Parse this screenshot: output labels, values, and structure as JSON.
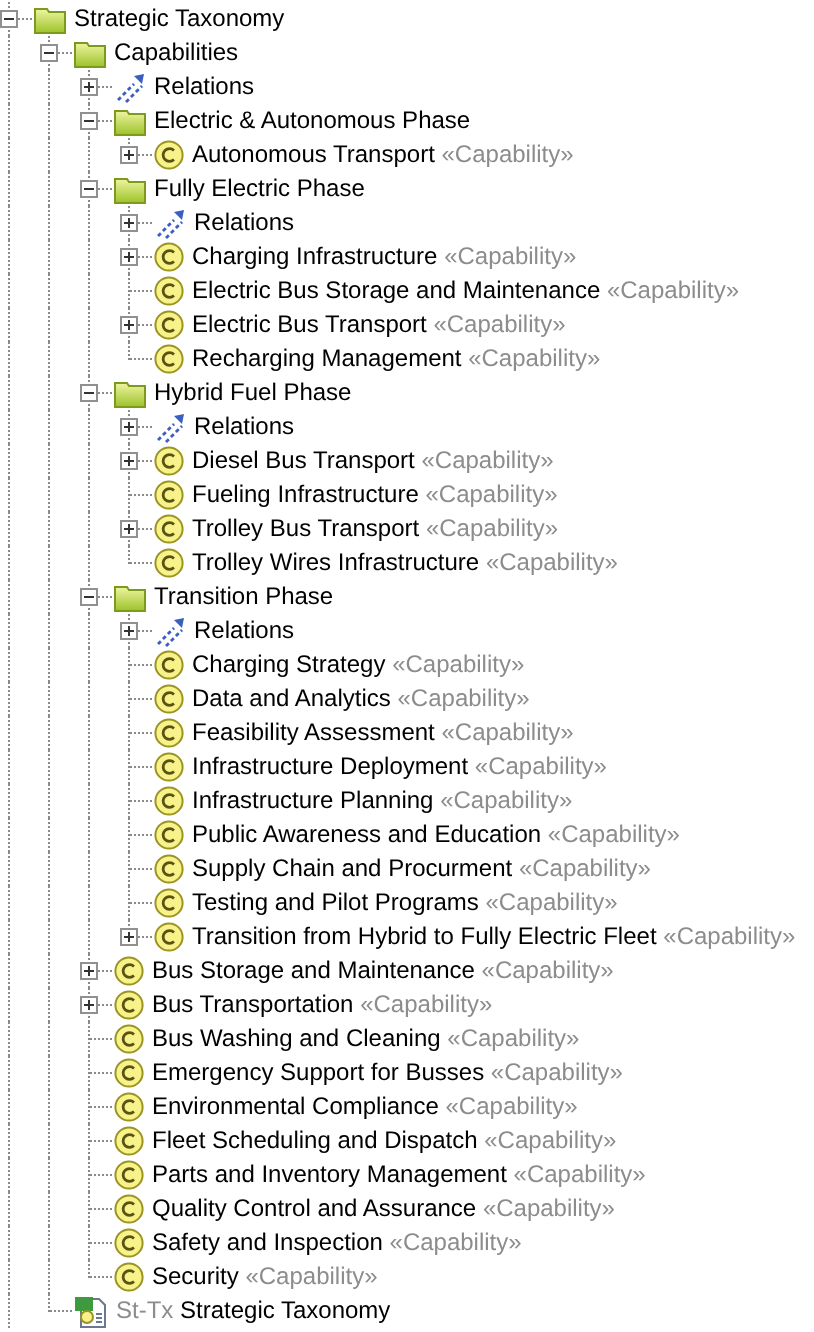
{
  "tree": [
    {
      "label": "Strategic Taxonomy",
      "kind": "folder",
      "expanded": true,
      "children": [
        {
          "label": "Capabilities",
          "kind": "folder",
          "expanded": true,
          "children": [
            {
              "label": "Relations",
              "kind": "relations",
              "expanded": false
            },
            {
              "label": "Electric & Autonomous Phase",
              "kind": "folder",
              "expanded": true,
              "children": [
                {
                  "label": "Autonomous Transport",
                  "kind": "capability",
                  "stereotype": "«Capability»",
                  "expanded": false
                }
              ]
            },
            {
              "label": "Fully Electric Phase",
              "kind": "folder",
              "expanded": true,
              "children": [
                {
                  "label": "Relations",
                  "kind": "relations",
                  "expanded": false
                },
                {
                  "label": "Charging Infrastructure",
                  "kind": "capability",
                  "stereotype": "«Capability»",
                  "expanded": false
                },
                {
                  "label": "Electric Bus Storage and Maintenance",
                  "kind": "capability",
                  "stereotype": "«Capability»"
                },
                {
                  "label": "Electric Bus Transport",
                  "kind": "capability",
                  "stereotype": "«Capability»",
                  "expanded": false
                },
                {
                  "label": "Recharging Management",
                  "kind": "capability",
                  "stereotype": "«Capability»"
                }
              ]
            },
            {
              "label": "Hybrid Fuel Phase",
              "kind": "folder",
              "expanded": true,
              "children": [
                {
                  "label": "Relations",
                  "kind": "relations",
                  "expanded": false
                },
                {
                  "label": "Diesel Bus Transport",
                  "kind": "capability",
                  "stereotype": "«Capability»",
                  "expanded": false
                },
                {
                  "label": "Fueling Infrastructure",
                  "kind": "capability",
                  "stereotype": "«Capability»"
                },
                {
                  "label": "Trolley Bus Transport",
                  "kind": "capability",
                  "stereotype": "«Capability»",
                  "expanded": false
                },
                {
                  "label": "Trolley Wires Infrastructure",
                  "kind": "capability",
                  "stereotype": "«Capability»"
                }
              ]
            },
            {
              "label": "Transition Phase",
              "kind": "folder",
              "expanded": true,
              "children": [
                {
                  "label": "Relations",
                  "kind": "relations",
                  "expanded": false
                },
                {
                  "label": "Charging Strategy",
                  "kind": "capability",
                  "stereotype": "«Capability»"
                },
                {
                  "label": "Data and Analytics",
                  "kind": "capability",
                  "stereotype": "«Capability»"
                },
                {
                  "label": "Feasibility Assessment",
                  "kind": "capability",
                  "stereotype": "«Capability»"
                },
                {
                  "label": "Infrastructure Deployment",
                  "kind": "capability",
                  "stereotype": "«Capability»"
                },
                {
                  "label": "Infrastructure Planning",
                  "kind": "capability",
                  "stereotype": "«Capability»"
                },
                {
                  "label": "Public Awareness and Education",
                  "kind": "capability",
                  "stereotype": "«Capability»"
                },
                {
                  "label": "Supply Chain and Procurment",
                  "kind": "capability",
                  "stereotype": "«Capability»"
                },
                {
                  "label": "Testing and Pilot Programs",
                  "kind": "capability",
                  "stereotype": "«Capability»"
                },
                {
                  "label": "Transition from Hybrid to Fully Electric Fleet",
                  "kind": "capability",
                  "stereotype": "«Capability»",
                  "expanded": false
                }
              ]
            },
            {
              "label": "Bus Storage and Maintenance",
              "kind": "capability",
              "stereotype": "«Capability»",
              "expanded": false
            },
            {
              "label": "Bus Transportation",
              "kind": "capability",
              "stereotype": "«Capability»",
              "expanded": false
            },
            {
              "label": "Bus Washing and Cleaning",
              "kind": "capability",
              "stereotype": "«Capability»"
            },
            {
              "label": "Emergency Support for Busses",
              "kind": "capability",
              "stereotype": "«Capability»"
            },
            {
              "label": "Environmental Compliance",
              "kind": "capability",
              "stereotype": "«Capability»"
            },
            {
              "label": "Fleet Scheduling and Dispatch",
              "kind": "capability",
              "stereotype": "«Capability»"
            },
            {
              "label": "Parts and Inventory Management",
              "kind": "capability",
              "stereotype": "«Capability»"
            },
            {
              "label": "Quality Control and Assurance",
              "kind": "capability",
              "stereotype": "«Capability»"
            },
            {
              "label": "Safety and Inspection",
              "kind": "capability",
              "stereotype": "«Capability»"
            },
            {
              "label": "Security",
              "kind": "capability",
              "stereotype": "«Capability»"
            }
          ]
        },
        {
          "label": "Strategic Taxonomy",
          "kind": "taxonomy",
          "prefix": "St-Tx"
        }
      ]
    }
  ]
}
